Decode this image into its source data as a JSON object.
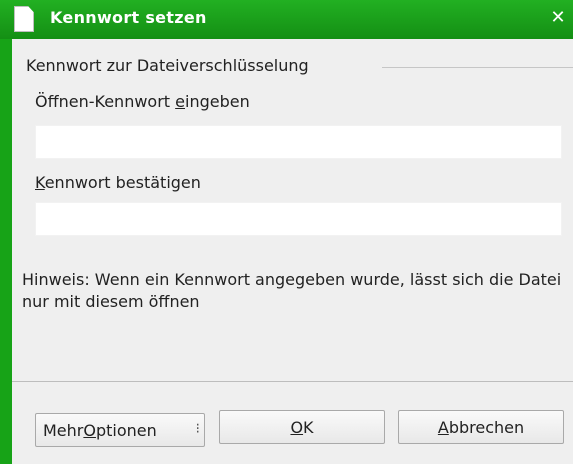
{
  "window": {
    "title": "Kennwort setzen",
    "close_glyph": "✕"
  },
  "group": {
    "label": "Kennwort zur Dateiverschlüsselung"
  },
  "open_password": {
    "label_pre": "Öffnen-Kennwort ",
    "label_mnemonic": "e",
    "label_post": "ingeben",
    "value": ""
  },
  "confirm_password": {
    "label_mnemonic": "K",
    "label_post": "ennwort bestätigen",
    "value": ""
  },
  "hint": {
    "text": "Hinweis: Wenn ein Kennwort angegeben wurde, lässt sich die Datei nur mit diesem öffnen"
  },
  "buttons": {
    "more_pre": "Mehr ",
    "more_mnemonic": "O",
    "more_post": "ptionen",
    "more_indicator": "⁝",
    "ok_mnemonic": "O",
    "ok_post": "K",
    "cancel_mnemonic": "A",
    "cancel_post": "bbrechen"
  },
  "colors": {
    "titlebar": "#148f14",
    "background": "#efefef"
  }
}
